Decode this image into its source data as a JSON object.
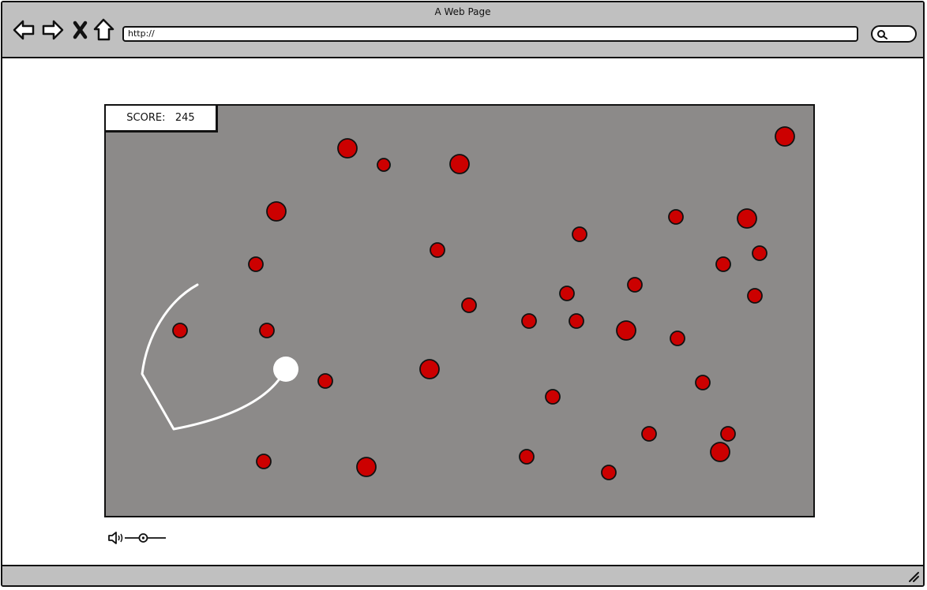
{
  "browser": {
    "title": "A Web Page",
    "url": "http://",
    "icons": [
      "back-arrow-icon",
      "forward-arrow-icon",
      "close-x-icon",
      "home-icon",
      "search-icon"
    ]
  },
  "game": {
    "score_label": "SCORE:",
    "score_value": "245",
    "background_color": "#8c8a89",
    "enemy_color": "#cc0000",
    "player_color": "#ffffff"
  },
  "volume": {
    "icon": "speaker-icon",
    "level": 0.45
  }
}
